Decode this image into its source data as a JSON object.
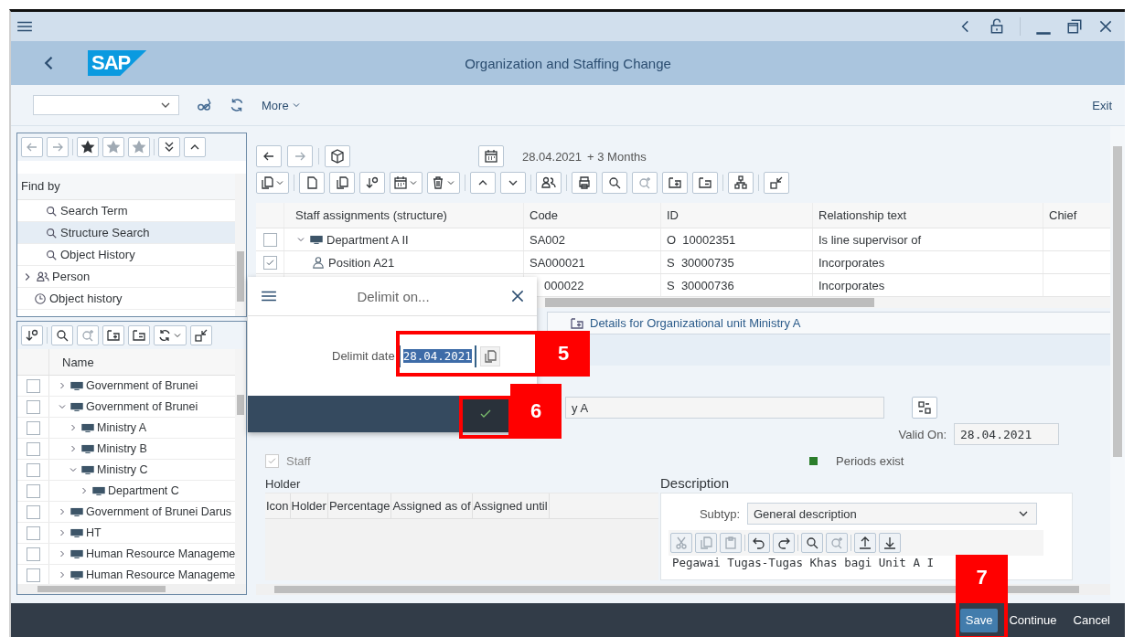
{
  "title_bar": {
    "logo": "SAP",
    "title": "Organization and Staffing Change"
  },
  "toolbar": {
    "more": "More",
    "exit": "Exit"
  },
  "find_panel": {
    "header": "Find by",
    "items": [
      {
        "kind": "search",
        "label": "Search Term",
        "selected": false
      },
      {
        "kind": "search",
        "label": "Structure Search",
        "selected": true
      },
      {
        "kind": "search",
        "label": "Object History",
        "selected": false
      },
      {
        "kind": "group",
        "label": "Person",
        "selected": false,
        "expanded": false
      },
      {
        "kind": "history",
        "label": "Object history",
        "selected": false
      }
    ]
  },
  "tree": {
    "header": "Name",
    "rows": [
      {
        "label": "Government of Brunei",
        "checked": false,
        "expanded": false
      },
      {
        "label": "Government of Brunei",
        "checked": false,
        "expanded": true,
        "children": [
          {
            "label": "Ministry A",
            "checked": false,
            "expanded": false
          },
          {
            "label": "Ministry B",
            "checked": false,
            "expanded": false
          },
          {
            "label": "Ministry C",
            "checked": false,
            "expanded": true,
            "children": [
              {
                "label": "Department C",
                "checked": false,
                "expanded": false
              }
            ]
          }
        ]
      },
      {
        "label": "Government of Brunei Darus",
        "checked": false,
        "expanded": false
      },
      {
        "label": "HT",
        "checked": false,
        "expanded": false
      },
      {
        "label": "Human Resource Manageme",
        "checked": false,
        "expanded": false
      },
      {
        "label": "Human Resource Manageme",
        "checked": false,
        "expanded": false
      }
    ]
  },
  "date_bar": {
    "date": "28.04.2021",
    "range": "+ 3 Months"
  },
  "table": {
    "columns": [
      "Staff assignments (structure)",
      "Code",
      "ID",
      "Relationship text",
      "Chief"
    ],
    "rows": [
      {
        "kind": "orgunit",
        "name": "Department A II",
        "expanded": true,
        "checked": false,
        "code": "SA002",
        "id": "O  10002351",
        "relationship": "Is line supervisor of"
      },
      {
        "kind": "position",
        "name": "Position A21",
        "checked": true,
        "code": "SA000021",
        "id": "S  30000735",
        "relationship": "Incorporates"
      },
      {
        "kind": "hidden",
        "code": "000022",
        "id": "S  30000736",
        "relationship": "Incorporates"
      }
    ]
  },
  "details": {
    "title": "Details for Organizational unit Ministry A",
    "name_value": "y A",
    "valid_on_label": "Valid On:",
    "valid_on": "28.04.2021",
    "staff": {
      "label": "Staff",
      "checked": true,
      "disabled": true
    },
    "status": {
      "label": "Periods exist"
    }
  },
  "holder": {
    "title": "Holder",
    "columns": [
      "Icon",
      "Holder",
      "Percentage",
      "Assigned as of",
      "Assigned until"
    ]
  },
  "description": {
    "title": "Description",
    "subtype_label": "Subtyp:",
    "subtype": "General description",
    "text": "Pegawai Tugas-Tugas Khas bagi Unit A I"
  },
  "footer": {
    "buttons": [
      {
        "kind": "emphasized",
        "label": "Save"
      },
      {
        "kind": "plain",
        "label": "Continue"
      },
      {
        "kind": "plain",
        "label": "Cancel"
      }
    ]
  },
  "dialog": {
    "title": "Delimit on...",
    "field_label": "Delimit date",
    "field_value": "28.04.2021",
    "value_selected": true
  },
  "callouts": [
    {
      "label": "5"
    },
    {
      "label": "6"
    },
    {
      "label": "7"
    }
  ]
}
